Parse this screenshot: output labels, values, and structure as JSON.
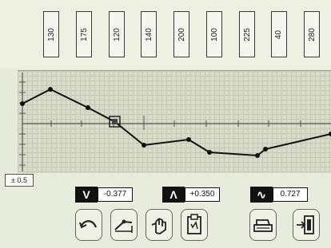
{
  "channel_values": [
    "130",
    "175",
    "120",
    "140",
    "200",
    "100",
    "225",
    "40",
    "280"
  ],
  "scale_label": "± 0.5",
  "measurements": [
    {
      "icon": "V",
      "value": "-0.377"
    },
    {
      "icon": "Λ",
      "value": "+0.350"
    },
    {
      "icon": "∿",
      "value": "0.727"
    }
  ],
  "toolbar": [
    "undo-icon",
    "draw-curve-icon",
    "adjust-hand-icon",
    "clipboard-icon",
    "print-icon",
    "exit-icon"
  ],
  "colors": {
    "trace": "#111111",
    "grid": "#c6cab5",
    "plot_bg": "#d7dbc7"
  }
}
